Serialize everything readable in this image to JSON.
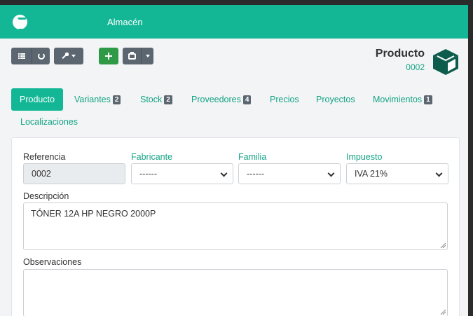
{
  "navbar": {
    "title": "Almacén",
    "logo_icon": "facturascripts-logo-icon"
  },
  "toolbar": {
    "buttons": [
      "list-icon",
      "refresh-icon",
      "wrench-icon",
      "plus-icon",
      "print-icon"
    ]
  },
  "product": {
    "title": "Producto",
    "code": "0002",
    "icon": "cube-icon"
  },
  "tabs": [
    {
      "label": "Producto",
      "badge": ""
    },
    {
      "label": "Variantes",
      "badge": "2"
    },
    {
      "label": "Stock",
      "badge": "2"
    },
    {
      "label": "Proveedores",
      "badge": "4"
    },
    {
      "label": "Precios",
      "badge": ""
    },
    {
      "label": "Proyectos",
      "badge": ""
    },
    {
      "label": "Movimientos",
      "badge": "1"
    },
    {
      "label": "Localizaciones",
      "badge": ""
    }
  ],
  "form": {
    "referencia_label": "Referencia",
    "referencia_value": "0002",
    "fabricante_label": "Fabricante",
    "fabricante_value": "------",
    "familia_label": "Familia",
    "familia_value": "------",
    "impuesto_label": "Impuesto",
    "impuesto_value": "IVA 21%",
    "descripcion_label": "Descripción",
    "descripcion_value": "TÓNER 12A HP NEGRO 2000P",
    "observaciones_label": "Observaciones",
    "observaciones_value": ""
  },
  "colors": {
    "brand": "#13b796",
    "link": "#13a385",
    "button_grey": "#5b6670",
    "button_green": "#2e9a46",
    "cube": "#0d5c4c"
  }
}
